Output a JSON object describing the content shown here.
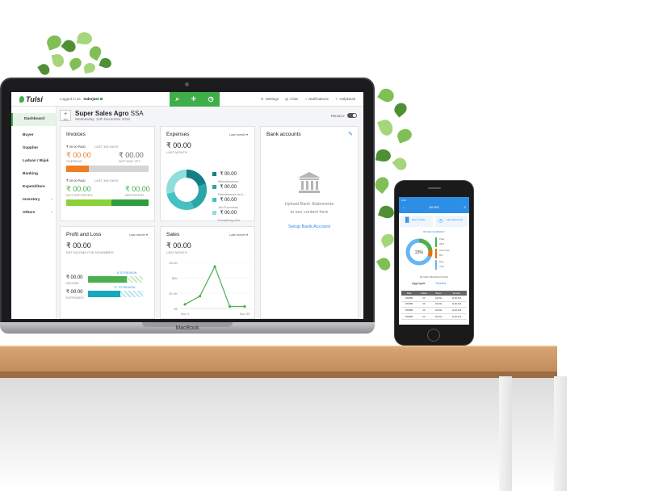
{
  "laptop": {
    "brand": "MacBook",
    "app": {
      "logo": "Tulsi",
      "logged_in_prefix": "Logged in as :",
      "user": "Inderjeet",
      "header_links": [
        "Settings",
        "Chat",
        "Notifications",
        "HelpDesk"
      ],
      "add_label": "Add",
      "company_name": "Super Sales Agro",
      "company_suffix": "SSA",
      "company_date": "Wednesday, 12th December 2018",
      "privacy_label": "PRIVACY",
      "sidebar": [
        {
          "label": "Dashboard",
          "active": true
        },
        {
          "label": "Buyer"
        },
        {
          "label": "Supplier"
        },
        {
          "label": "Ladaan / Bijak"
        },
        {
          "label": "Banking"
        },
        {
          "label": "Expenditure"
        },
        {
          "label": "Inventory",
          "chevron": "›"
        },
        {
          "label": "Others",
          "chevron": "›"
        }
      ],
      "invoices": {
        "title": "Invoices",
        "paid1": "₹ 00.00 PAID",
        "period": "LAST 365 DAYS",
        "overdue_amount": "₹ 00.00",
        "overdue_label": "OVERDUE",
        "notdue_amount": "₹ 00.00",
        "notdue_label": "NOT DUE YET",
        "paid2": "₹ 00.00 PAID",
        "period2": "LAST 365 DAYS",
        "notdeposited_amount": "₹ 00.00",
        "notdeposited_label": "NOT DEPOSITED",
        "deposited_amount": "₹ 00.00",
        "deposited_label": "DEPOSITED"
      },
      "expenses": {
        "title": "Expenses",
        "period_select": "Last month",
        "amount": "₹ 00.00",
        "period_label": "LAST MONTH",
        "legend": [
          {
            "amount": "₹ 00.00",
            "label": "Miscellaneous",
            "color": "#177e89"
          },
          {
            "amount": "₹ 00.00",
            "label": "Maintenance and ...",
            "color": "#2aa5a8"
          },
          {
            "amount": "₹ 00.00",
            "label": "Job Expenses",
            "color": "#45c1c1"
          },
          {
            "amount": "₹ 00.00",
            "label": "Everything else",
            "color": "#8fdedc"
          }
        ]
      },
      "bank": {
        "title": "Bank accounts",
        "message_line1": "Upload Bank Statements",
        "message_line2": "to see content here",
        "link": "Setup Bank Account"
      },
      "profit_loss": {
        "title": "Profit and Loss",
        "period_select": "Last month",
        "amount": "₹ 00.00",
        "caption": "NET INCOME FOR NOVEMBER",
        "income_amount": "₹ 00.00",
        "income_label": "INCOME",
        "income_review": "8 TO REVIEW",
        "expenses_amount": "₹ 00.00",
        "expenses_label": "EXPENSES",
        "expenses_review": "17 TO REVIEW"
      },
      "sales": {
        "title": "Sales",
        "period_select": "Last month",
        "amount": "₹ 00.00",
        "period_label": "LAST MONTH",
        "chart_data": {
          "type": "line",
          "y_ticks": [
            "$4.5K",
            "$3K",
            "$1.5K",
            "$0"
          ],
          "x_labels": [
            "Nov 1",
            "Nov 30"
          ],
          "ylim": [
            0,
            4500
          ],
          "x": [
            0,
            1,
            2,
            3,
            4
          ],
          "values": [
            400,
            1200,
            4100,
            200,
            200
          ]
        }
      }
    }
  },
  "phone": {
    "header_title": "BUYER",
    "status_time": "9:41",
    "tile1": "Buyer Totals",
    "tile2": "Late Payments",
    "summary_label": "BUYER SUMMARY",
    "donut_center": "23%",
    "legend": [
      {
        "label": "Paid",
        "value": "23%",
        "color": "#4caf50"
      },
      {
        "label": "Over Due",
        "value": "8%",
        "color": "#ef6c00"
      },
      {
        "label": "Due",
        "value": "72%",
        "color": "#64b5f6"
      }
    ],
    "transactions_label": "BUYER TRANSACTIONS",
    "tab_aggregate": "Aggregate",
    "tab_timeline": "Timeline",
    "table_headers": [
      "Date",
      "Crates",
      "Buyer",
      "Amount"
    ],
    "table_rows": [
      [
        "DD/MM",
        "20",
        "JohnSn",
        "11,00,341"
      ],
      [
        "DD/MM",
        "20",
        "JohnSn",
        "11,00,341"
      ],
      [
        "DD/MM",
        "20",
        "JohnSn",
        "11,00,341"
      ],
      [
        "DD/MM",
        "20",
        "JohnSn",
        "11,00,341"
      ]
    ]
  }
}
